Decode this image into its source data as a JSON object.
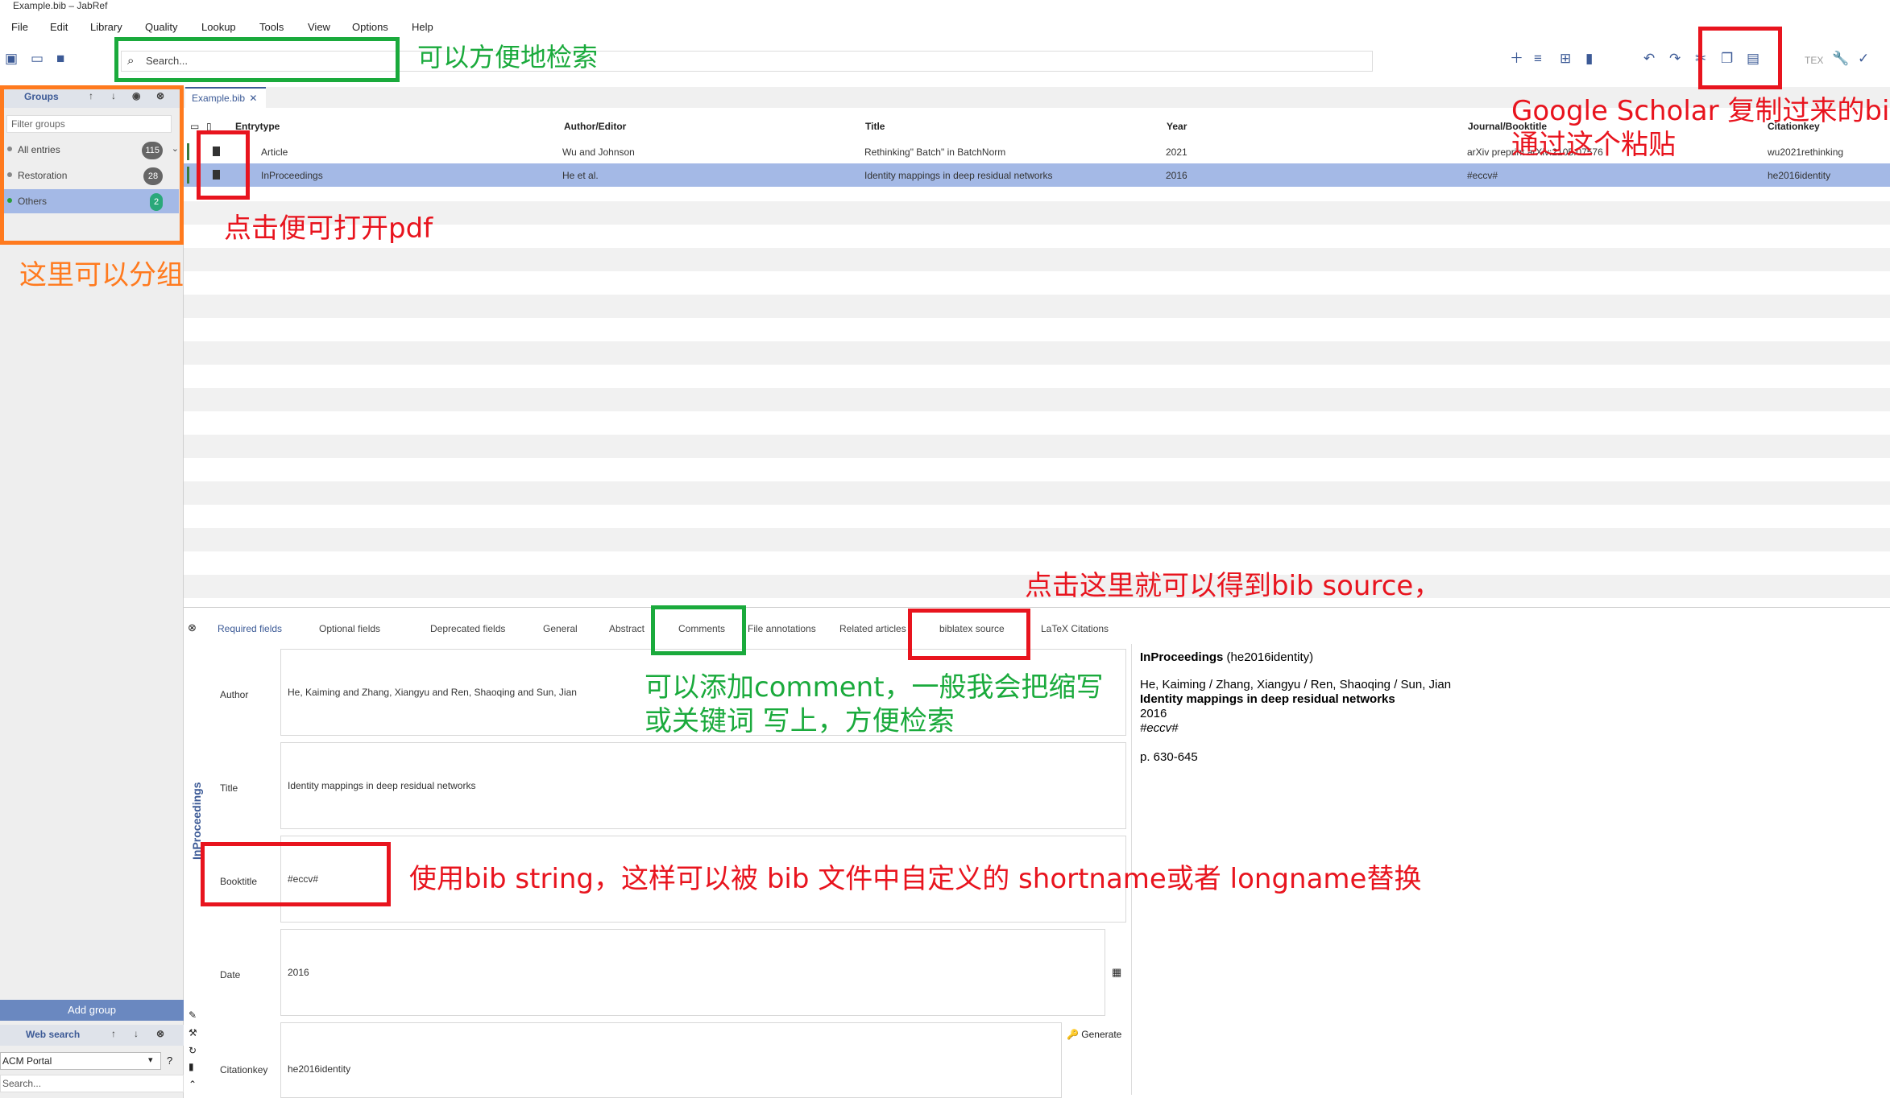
{
  "window": {
    "title": "Example.bib – JabRef"
  },
  "menu": [
    "File",
    "Edit",
    "Library",
    "Quality",
    "Lookup",
    "Tools",
    "View",
    "Options",
    "Help"
  ],
  "search": {
    "placeholder": "Search..."
  },
  "library_tab": {
    "label": "Example.bib"
  },
  "groups": {
    "title": "Groups",
    "filter_placeholder": "Filter groups",
    "items": [
      {
        "label": "All entries",
        "count": "115"
      },
      {
        "label": "Restoration",
        "count": "28"
      },
      {
        "label": "Others",
        "count": "2"
      }
    ],
    "add_group": "Add group"
  },
  "web_search": {
    "title": "Web search",
    "fetcher": "ACM Portal",
    "placeholder": "Search..."
  },
  "table": {
    "columns": [
      "Entrytype",
      "Author/Editor",
      "Title",
      "Year",
      "Journal/Booktitle",
      "Citationkey"
    ],
    "rows": [
      {
        "type": "Article",
        "author": "Wu and Johnson",
        "title": "Rethinking\" Batch\" in BatchNorm",
        "year": "2021",
        "journal": "arXiv preprint arXiv:2105.07576",
        "key": "wu2021rethinking"
      },
      {
        "type": "InProceedings",
        "author": "He et al.",
        "title": "Identity mappings in deep residual networks",
        "year": "2016",
        "journal": "#eccv#",
        "key": "he2016identity"
      }
    ]
  },
  "editor": {
    "side_label": "InProceedings",
    "tabs": [
      "Required fields",
      "Optional fields",
      "Deprecated fields",
      "General",
      "Abstract",
      "Comments",
      "File annotations",
      "Related articles",
      "biblatex source",
      "LaTeX Citations"
    ],
    "fields": {
      "author_label": "Author",
      "author": "He, Kaiming and Zhang, Xiangyu and Ren, Shaoqing and Sun, Jian",
      "title_label": "Title",
      "title": "Identity mappings in deep residual networks",
      "booktitle_label": "Booktitle",
      "booktitle": "#eccv#",
      "date_label": "Date",
      "date": "2016",
      "citationkey_label": "Citationkey",
      "citationkey": "he2016identity",
      "generate": "Generate"
    }
  },
  "preview": {
    "type": "InProceedings",
    "key": "(he2016identity)",
    "authors": "He, Kaiming / Zhang, Xiangyu / Ren, Shaoqing / Sun, Jian",
    "title": "Identity mappings in deep residual networks",
    "year": "2016",
    "booktitle": "#eccv#",
    "pages": "p. 630-645"
  },
  "annotations": {
    "search": "可以方便地检索",
    "paste_line1": "Google Scholar 复制过来的bib",
    "paste_line2": "通过这个粘贴",
    "pdf": "点击便可打开pdf",
    "groups": "这里可以分组",
    "source": "点击这里就可以得到bib source，",
    "comment_line1": "可以添加comment，一般我会把缩写",
    "comment_line2": "或关键词 写上，方便检索",
    "bibstring": "使用bib string，这样可以被 bib 文件中自定义的 shortname或者 longname替换"
  },
  "colors": {
    "green": "#1aaa3c",
    "red": "#e8141e",
    "orange": "#ff7a1e",
    "accent": "#3c5a96",
    "selected_row": "#a4b9e6"
  }
}
